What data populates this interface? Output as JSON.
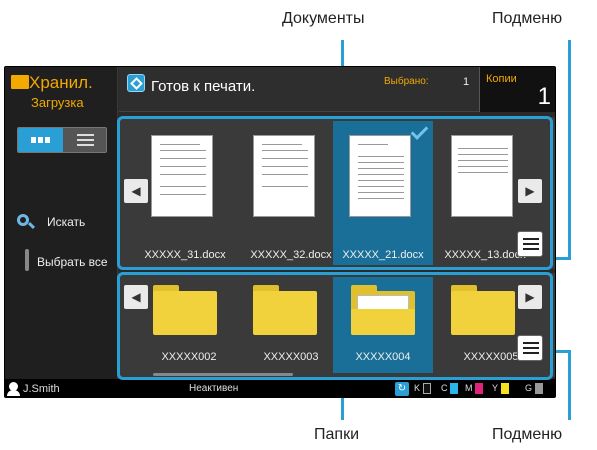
{
  "callouts": {
    "documents": "Документы",
    "submenu_top": "Подменю",
    "folders": "Папки",
    "submenu_bottom": "Подменю"
  },
  "sidebar": {
    "title": "Хранил.",
    "subtitle": "Загрузка",
    "search_label": "Искать",
    "select_all_label": "Выбрать все"
  },
  "header": {
    "status": "Готов к печати.",
    "selected_label": "Выбрано:",
    "selected_count": "1",
    "copies_label": "Копии",
    "copies_value": "1"
  },
  "documents": [
    {
      "name": "XXXXX_31.docx",
      "selected": false
    },
    {
      "name": "XXXXX_32.docx",
      "selected": false
    },
    {
      "name": "XXXXX_21.docx",
      "selected": true
    },
    {
      "name": "XXXXX_13.docx",
      "selected": false
    }
  ],
  "folders": [
    {
      "name": "XXXXX002",
      "selected": false
    },
    {
      "name": "XXXXX003",
      "selected": false
    },
    {
      "name": "XXXXX004",
      "selected": true
    },
    {
      "name": "XXXXX005",
      "selected": false
    }
  ],
  "statusbar": {
    "user": "J.Smith",
    "state": "Неактивен",
    "ink": [
      "K",
      "C",
      "M",
      "Y",
      "G"
    ]
  },
  "colors": {
    "accent": "#2a9fd6",
    "selection": "#1a6f98",
    "folder": "#f2d23c"
  }
}
